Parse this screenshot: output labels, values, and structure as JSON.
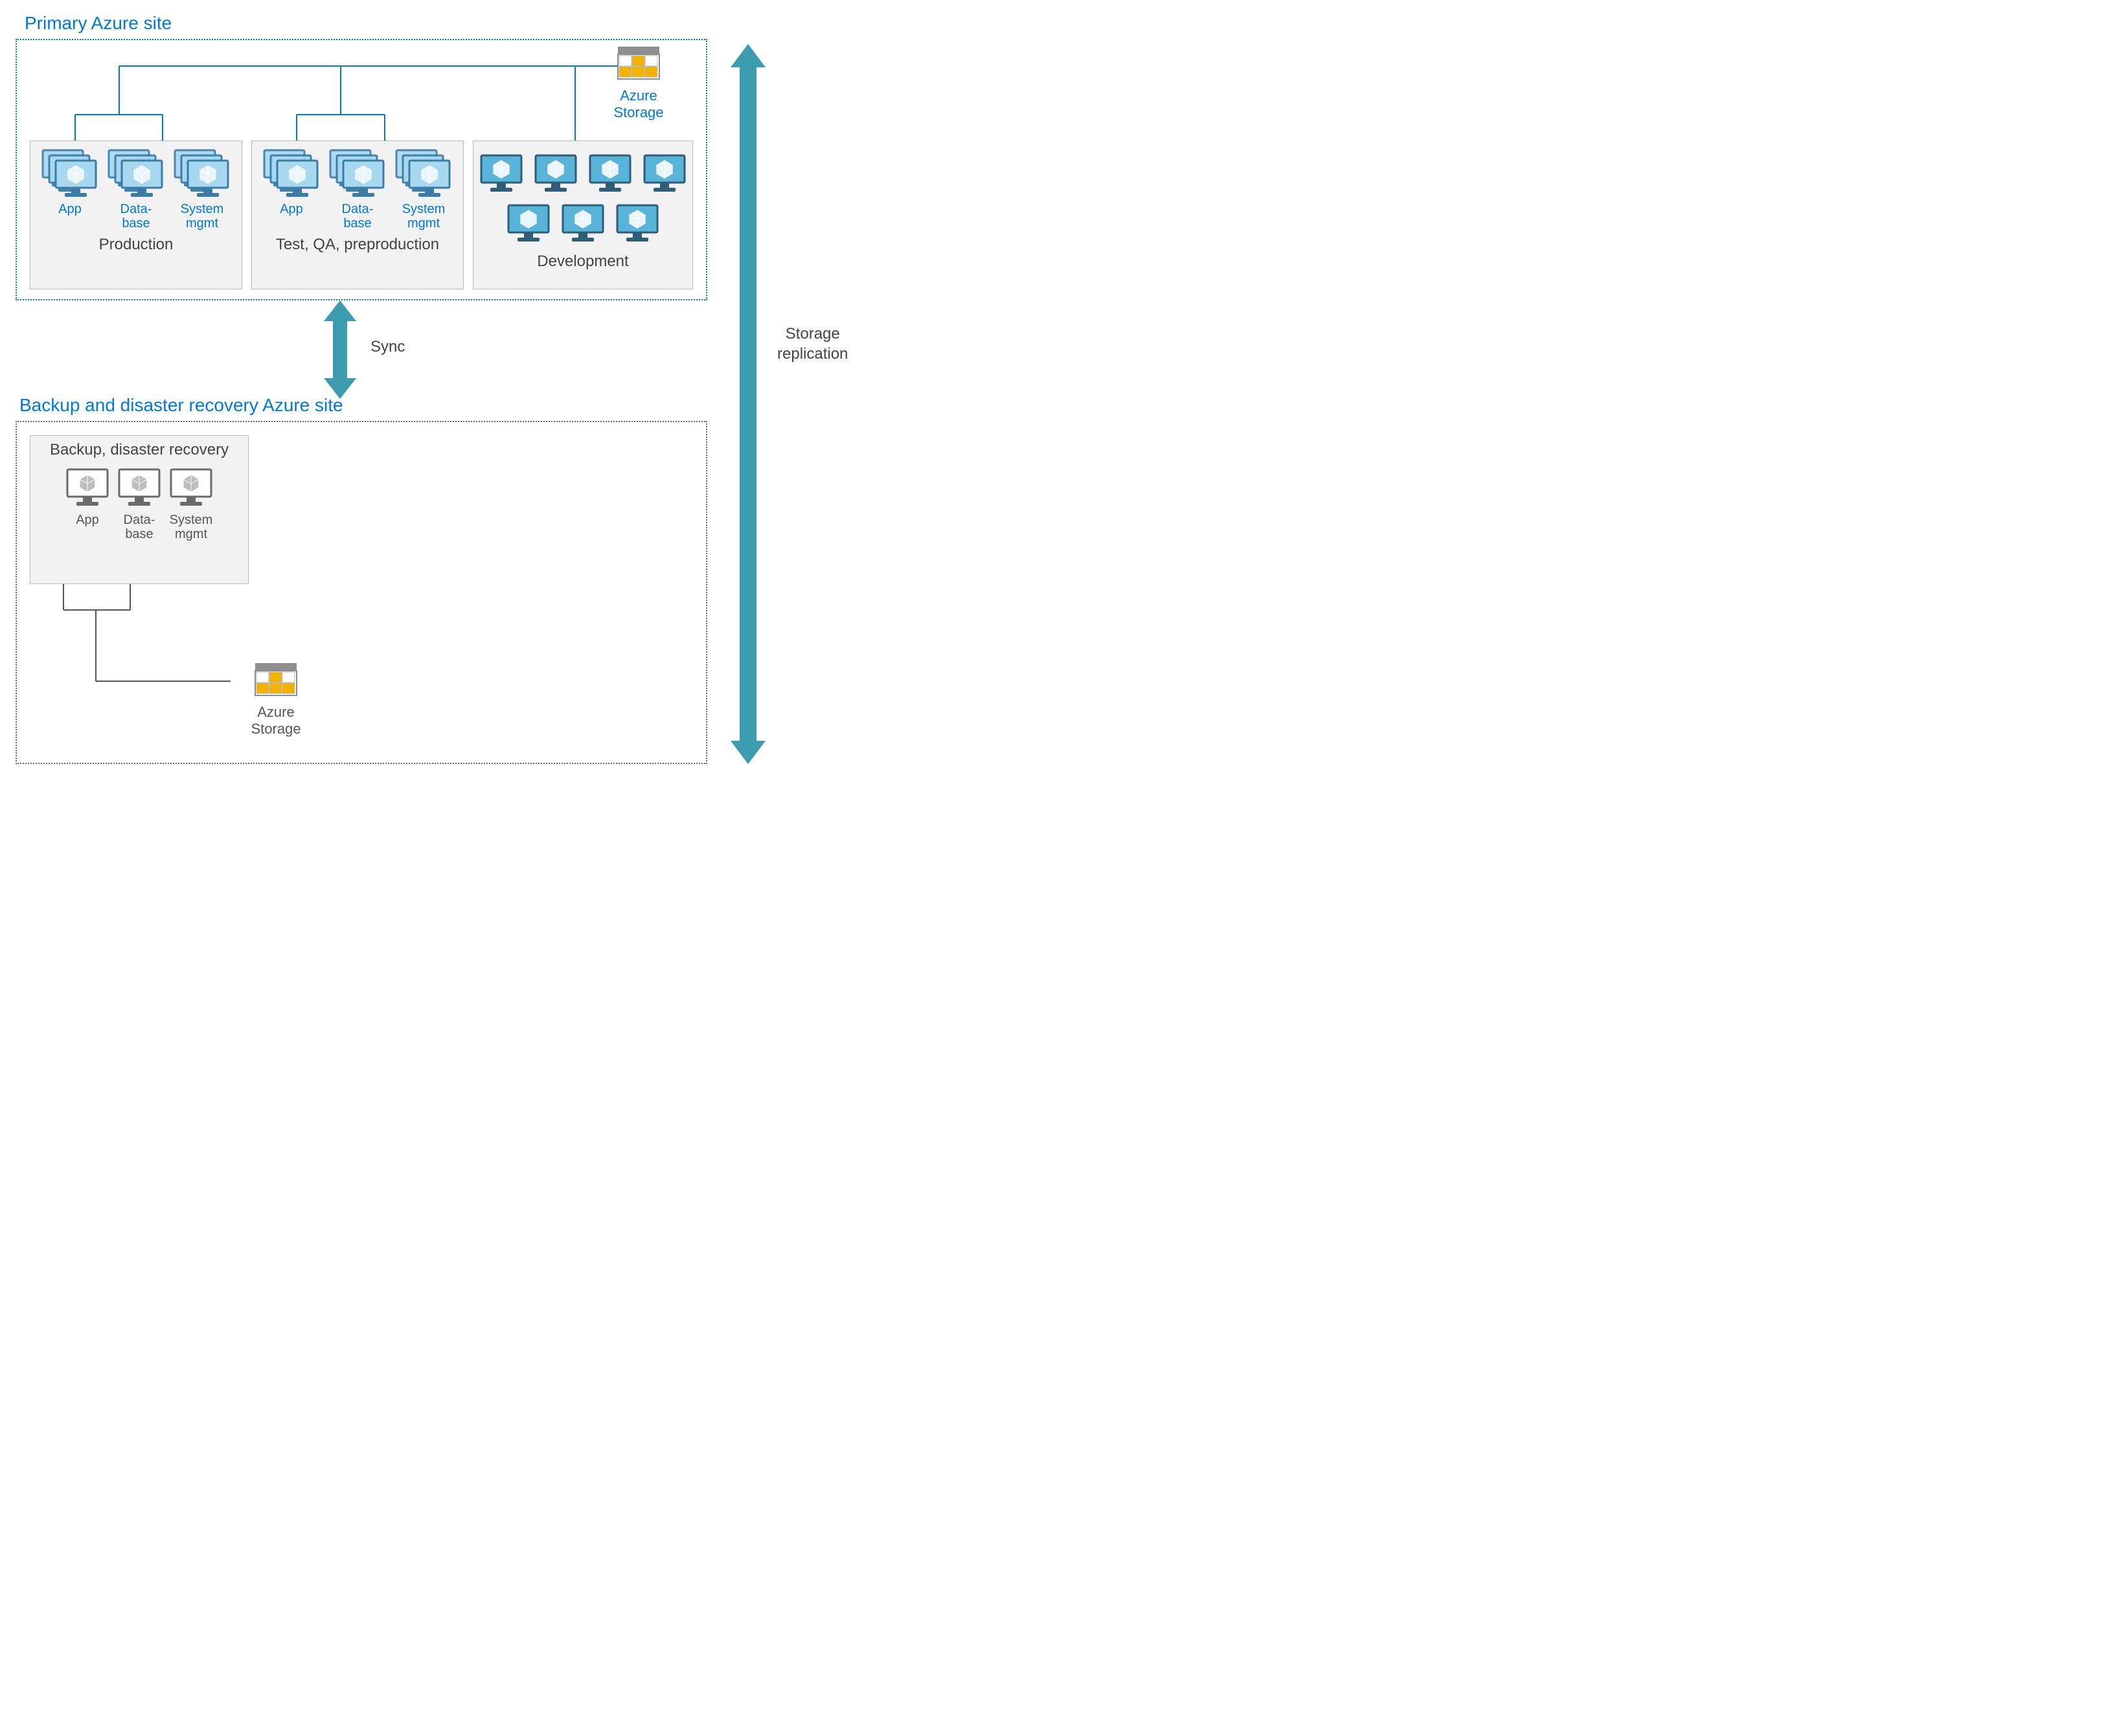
{
  "primary": {
    "title": "Primary Azure site",
    "storage_label": "Azure Storage",
    "environments": {
      "production": {
        "title": "Production",
        "groups": [
          {
            "label": "App"
          },
          {
            "label": "Data-\nbase"
          },
          {
            "label": "System\nmgmt"
          }
        ]
      },
      "test": {
        "title": "Test, QA, preproduction",
        "groups": [
          {
            "label": "App"
          },
          {
            "label": "Data-\nbase"
          },
          {
            "label": "System\nmgmt"
          }
        ]
      },
      "development": {
        "title": "Development"
      }
    }
  },
  "sync_label": "Sync",
  "storage_replication_label": "Storage\nreplication",
  "secondary": {
    "title": "Backup and disaster recovery Azure site",
    "env_title": "Backup, disaster recovery",
    "groups": [
      {
        "label": "App"
      },
      {
        "label": "Data-\nbase"
      },
      {
        "label": "System\nmgmt"
      }
    ],
    "storage_label": "Azure Storage"
  },
  "colors": {
    "azure_blue": "#0078d4",
    "light_blue": "#59b4d9",
    "teal_arrow": "#3d9bb0",
    "gray": "#666666",
    "amber": "#f2b200"
  }
}
